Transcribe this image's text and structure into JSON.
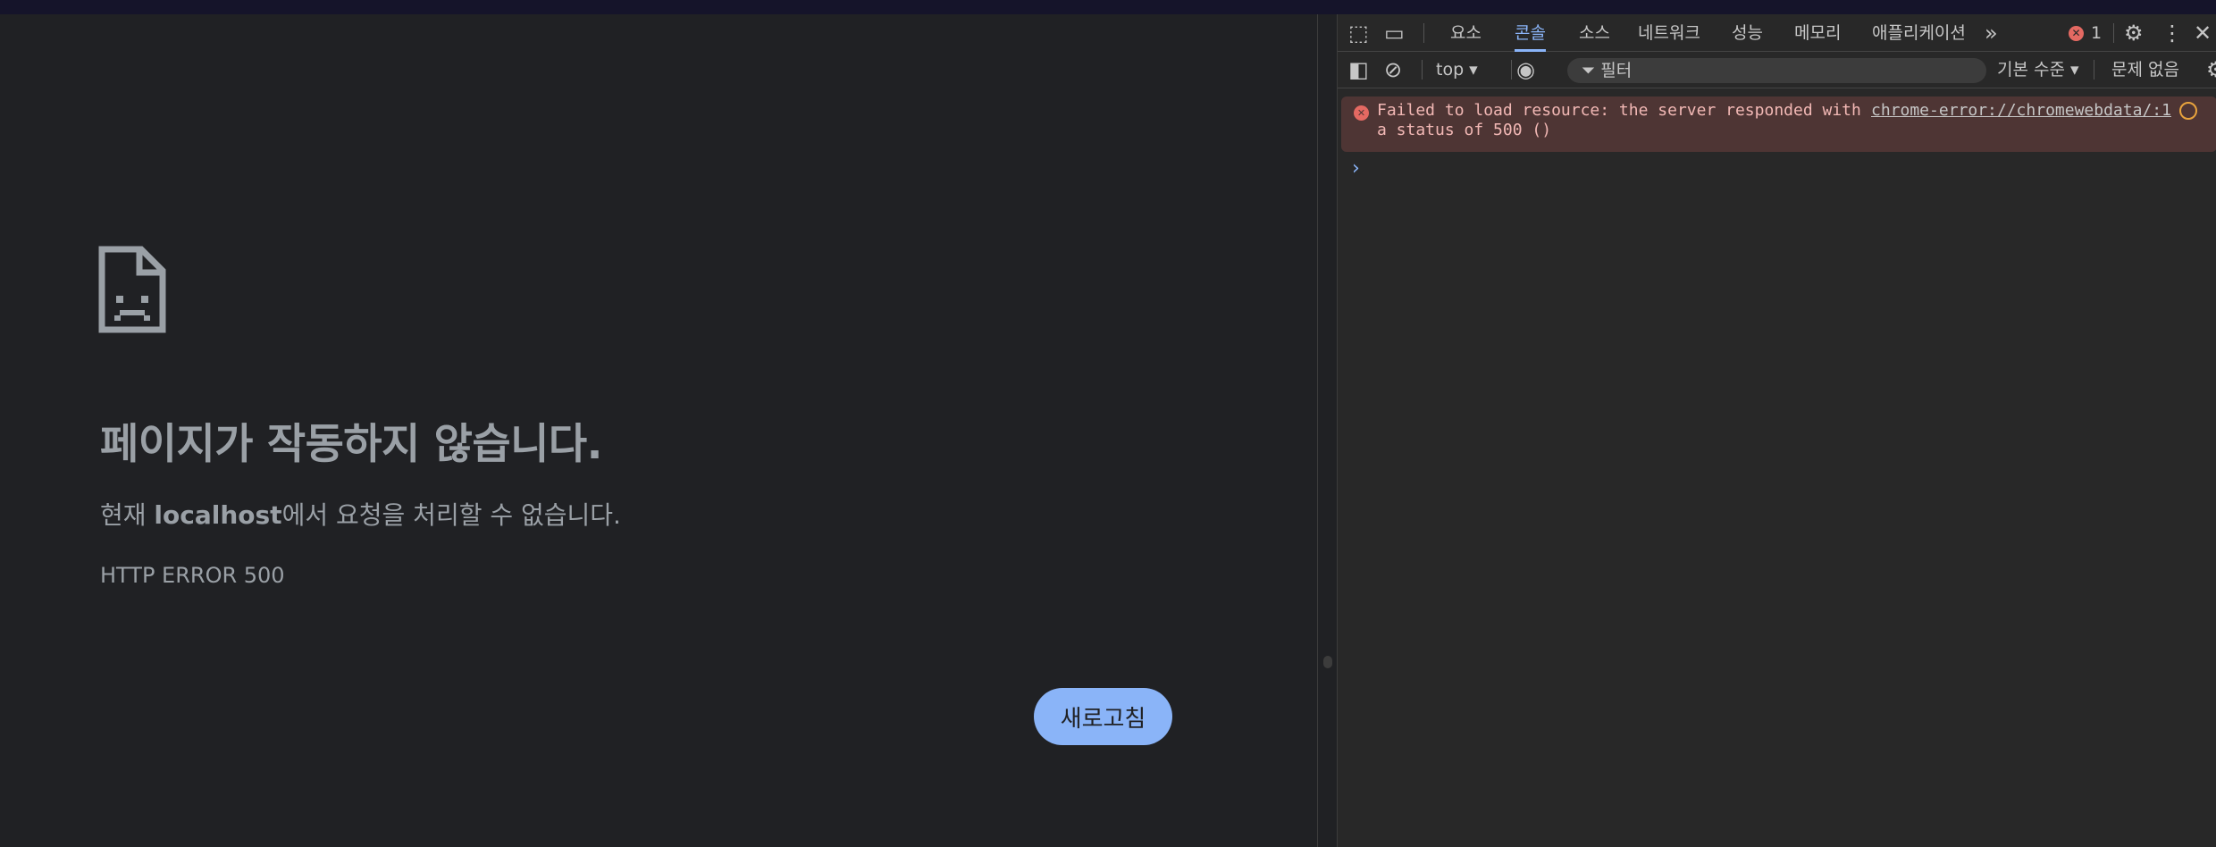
{
  "page": {
    "title": "페이지가 작동하지 않습니다.",
    "desc_prefix": "현재 ",
    "desc_host": "localhost",
    "desc_suffix": "에서 요청을 처리할 수 없습니다.",
    "error_code": "HTTP ERROR 500",
    "reload_label": "새로고침"
  },
  "devtools": {
    "tabs": [
      {
        "label": "요소",
        "active": false
      },
      {
        "label": "콘솔",
        "active": true
      },
      {
        "label": "소스",
        "active": false
      },
      {
        "label": "네트워크",
        "active": false
      },
      {
        "label": "성능",
        "active": false
      },
      {
        "label": "메모리",
        "active": false
      },
      {
        "label": "애플리케이션",
        "active": false
      }
    ],
    "more_tabs": "»",
    "error_count": "1",
    "context": "top",
    "filter_placeholder": "필터",
    "level": "기본 수준",
    "issues": "문제 없음",
    "console": {
      "message": "Failed to load resource: the server responded with\na status of 500 ()",
      "source": "chrome-error://chromewebdata/:1",
      "prompt": "›"
    }
  },
  "colors": {
    "accent": "#8ab4f8",
    "error": "#e46962",
    "page_bg": "#202124",
    "devtools_bg": "#282828"
  }
}
